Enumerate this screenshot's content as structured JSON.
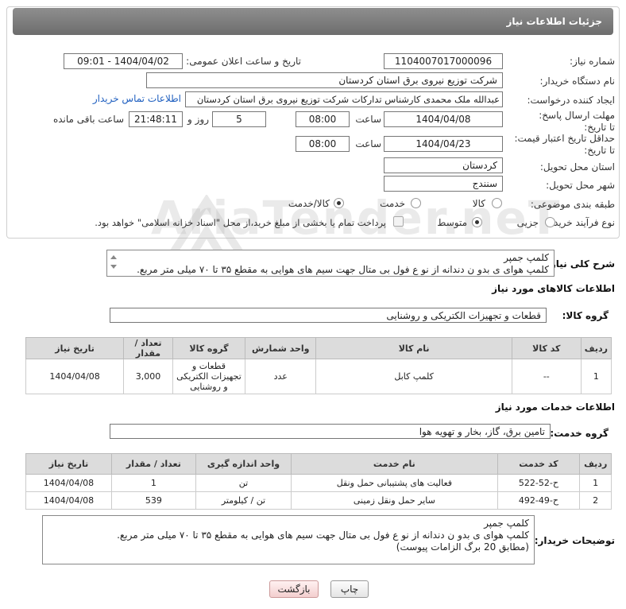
{
  "header": {
    "title": "جزئیات اطلاعات نیاز"
  },
  "need_number": {
    "label": "شماره نیاز:",
    "value": "1104007017000096"
  },
  "announce_datetime": {
    "label": "تاریخ و ساعت اعلان عمومی:",
    "value": "1404/04/02 - 09:01"
  },
  "buyer": {
    "label": "نام دستگاه خریدار:",
    "value": "شرکت توزیع نیروی برق استان کردستان"
  },
  "creator": {
    "label": "ایجاد کننده درخواست:",
    "value": "عبدالله ملک محمدی کارشناس تدارکات شرکت توزیع نیروی برق استان کردستان",
    "contact_link": "اطلاعات تماس خریدار"
  },
  "reply_deadline": {
    "label": "مهلت ارسال پاسخ: تا تاریخ:",
    "date": "1404/04/08",
    "time_label": "ساعت",
    "time": "08:00",
    "days": "5",
    "days_label": "روز و",
    "remaining": "21:48:11",
    "remaining_label": "ساعت باقی مانده"
  },
  "price_validity": {
    "label": "حداقل تاریخ اعتبار قیمت: تا تاریخ:",
    "date": "1404/04/23",
    "time_label": "ساعت",
    "time": "08:00"
  },
  "delivery_province": {
    "label": "استان محل تحویل:",
    "value": "کردستان"
  },
  "delivery_city": {
    "label": "شهر محل تحویل:",
    "value": "سنندج"
  },
  "category": {
    "label": "طبقه بندی موضوعی:",
    "options": [
      "کالا",
      "خدمت",
      "کالا/خدمت"
    ],
    "selected": "کالا/خدمت"
  },
  "purchase_process": {
    "label": "نوع فرآیند خرید :",
    "options": [
      "جزیی",
      "متوسط"
    ],
    "selected": "متوسط",
    "treasury_note": "پرداخت تمام یا بخشی از مبلغ خرید،از محل \"اسناد خزانه اسلامی\" خواهد بود."
  },
  "summary": {
    "label": "شرح کلی نیاز:",
    "line1": "کلمپ جمپر",
    "line2": "کلمپ هوای ی بدو ن دندانه از نو ع فول بی متال جهت سیم های هوایی به مقطع ۳۵ تا ۷۰ میلی متر مربع."
  },
  "goods_section": {
    "title": "اطلاعات کالاهای مورد نیاز"
  },
  "goods_group": {
    "label": "گروه کالا:",
    "value": "قطعات و تجهیزات الکتریکی و روشنایی"
  },
  "goods_table": {
    "headers": [
      "ردیف",
      "کد کالا",
      "نام کالا",
      "واحد شمارش",
      "گروه کالا",
      "تعداد / مقدار",
      "تاریخ نیاز"
    ],
    "rows": [
      [
        "1",
        "--",
        "کلمپ کابل",
        "عدد",
        "قطعات و تجهیزات الکتریکی و روشنایی",
        "3,000",
        "1404/04/08"
      ]
    ]
  },
  "services_section": {
    "title": "اطلاعات خدمات مورد نیاز"
  },
  "service_group": {
    "label": "گروه خدمت:",
    "value": "تامین برق، گاز، بخار و تهویه هوا"
  },
  "services_table": {
    "headers": [
      "ردیف",
      "کد خدمت",
      "نام خدمت",
      "واحد اندازه گیری",
      "تعداد / مقدار",
      "تاریخ نیاز"
    ],
    "rows": [
      [
        "1",
        "ح-52-522",
        "فعالیت های پشتیبانی حمل ونقل",
        "تن",
        "1",
        "1404/04/08"
      ],
      [
        "2",
        "ح-49-492",
        "سایر حمل ونقل زمینی",
        "تن / کیلومتر",
        "539",
        "1404/04/08"
      ]
    ]
  },
  "buyer_notes": {
    "label": "توضیحات خریدار:",
    "line1": "کلمپ جمپر",
    "line2": "کلمپ هوای ی بدو ن دندانه از نو ع فول بی متال جهت سیم های هوایی به مقطع ۳۵ تا ۷۰ میلی متر مربع.",
    "line3": "(مطابق 20  برگ الزامات پیوست)"
  },
  "buttons": {
    "print": "چاپ",
    "back": "بازگشت"
  },
  "watermark": {
    "text": "AriaTender.neT"
  },
  "colors": {
    "header_bg": "#7a7a7a",
    "link": "#2060c0",
    "back_button": "#f3cfcf"
  }
}
